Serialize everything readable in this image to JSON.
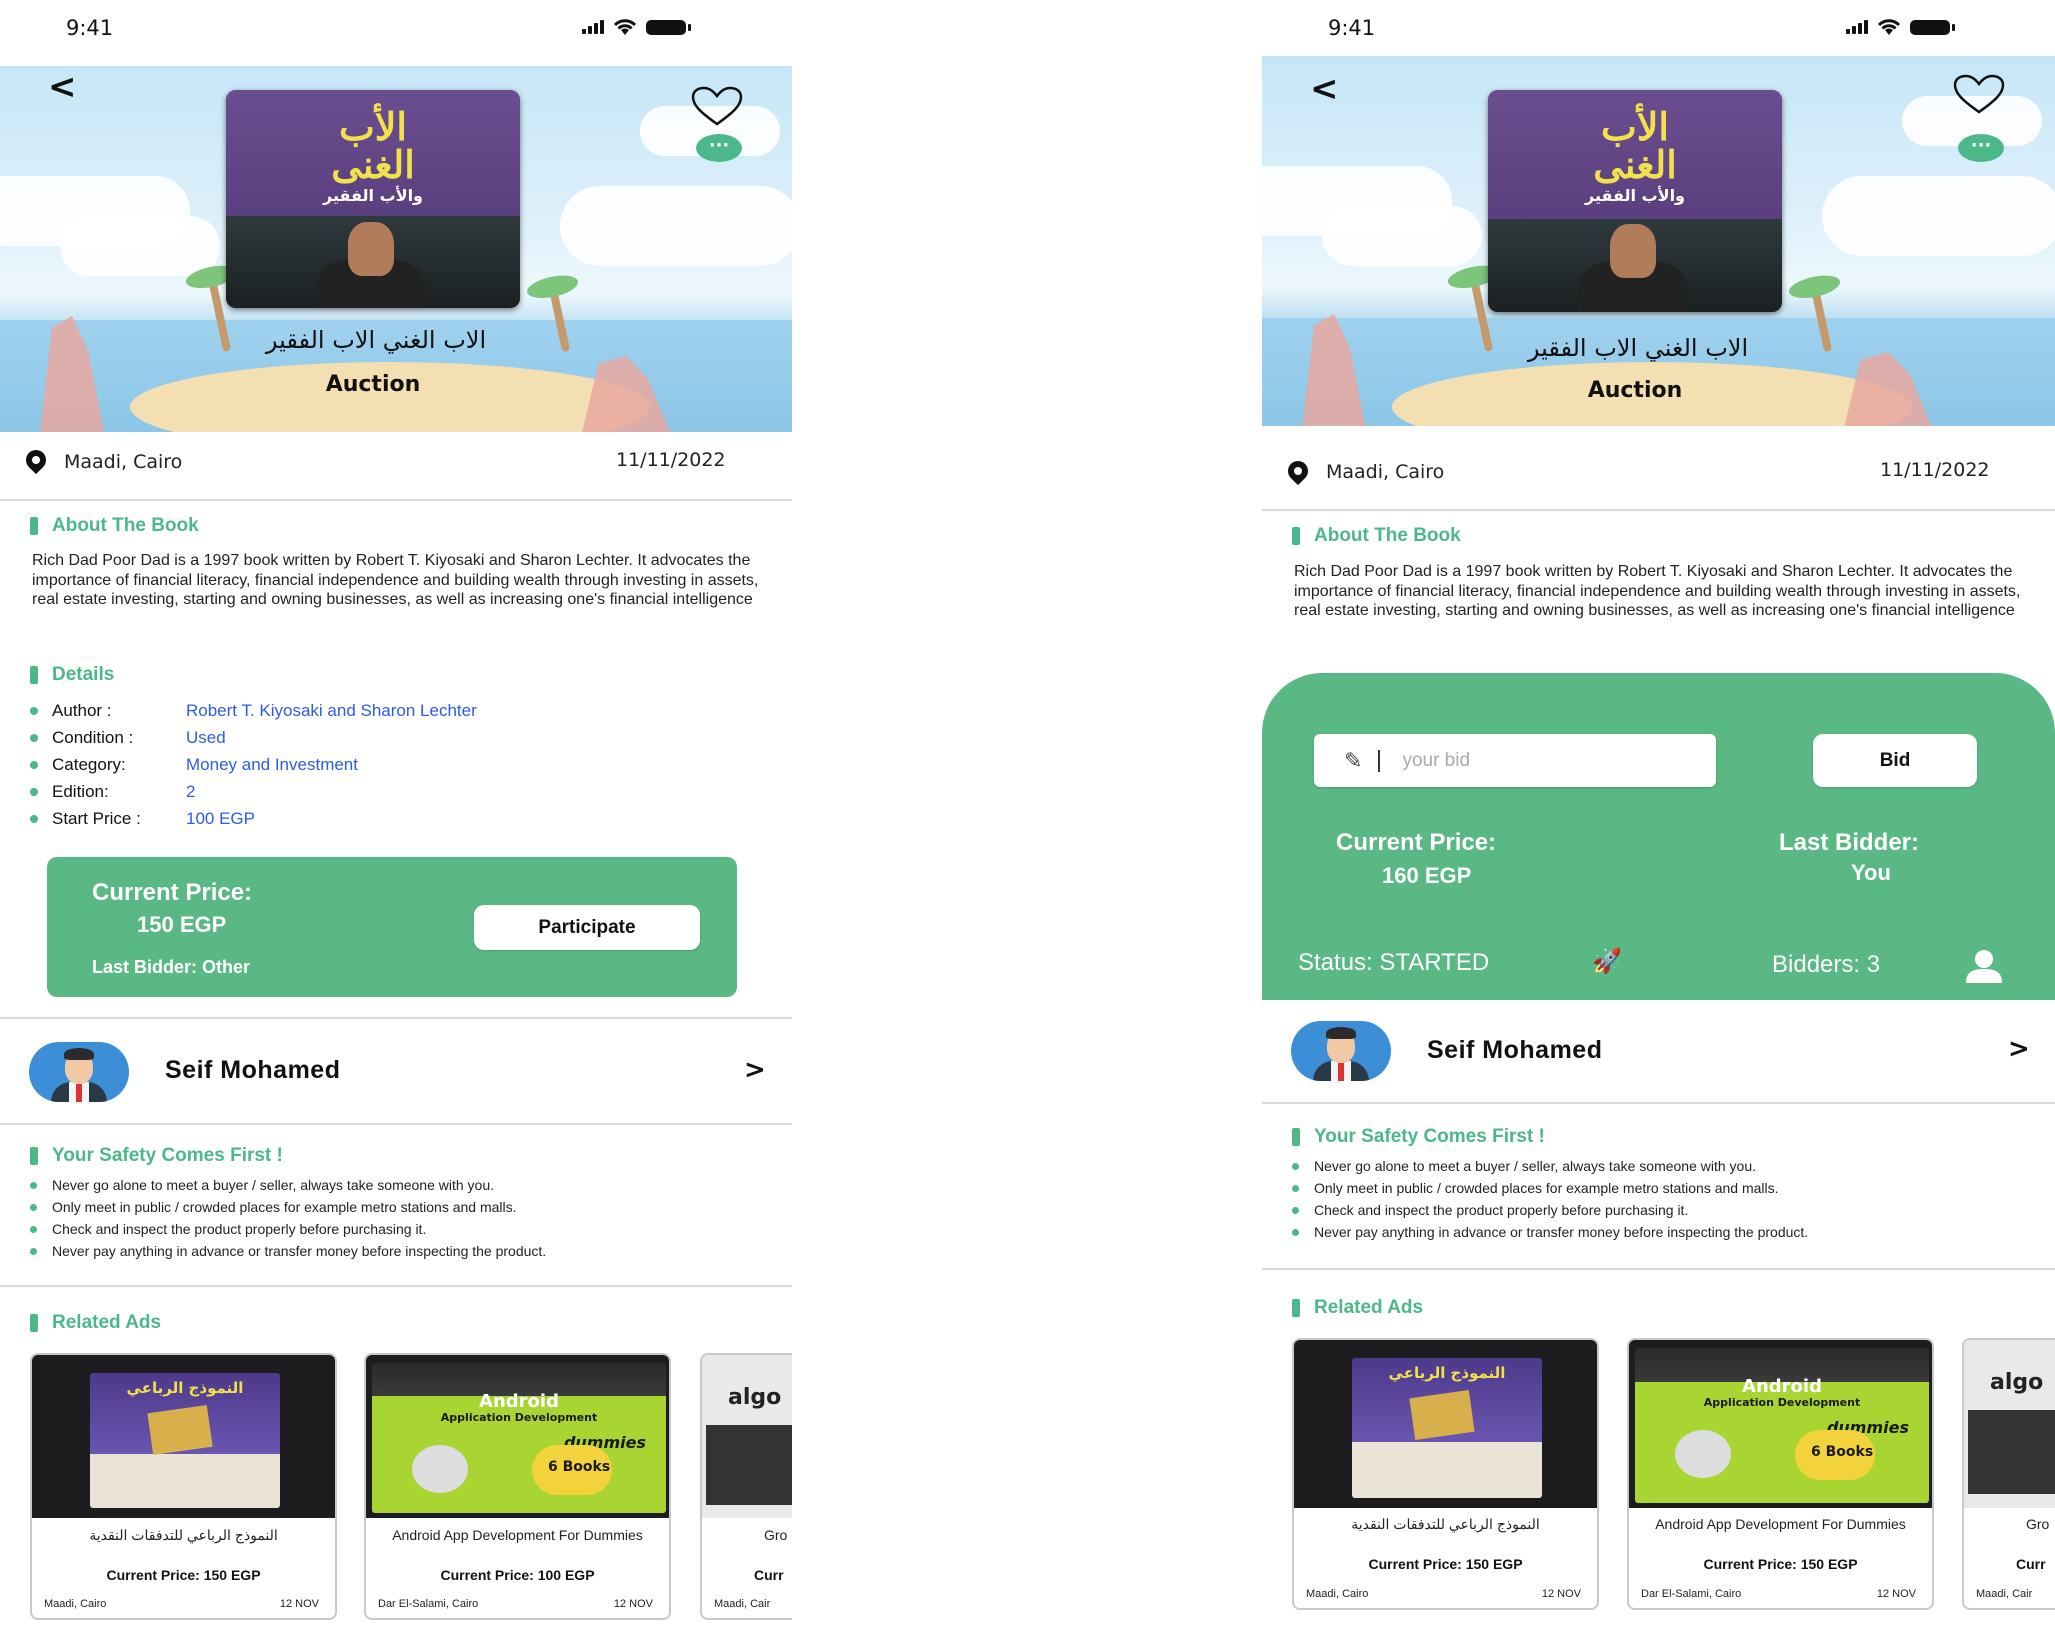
{
  "status_bar": {
    "time": "9:41"
  },
  "listing": {
    "title_ar": "الاب الغني الاب الفقير",
    "type": "Auction",
    "location": "Maadi, Cairo",
    "date": "11/11/2022",
    "cover": {
      "line1": "الأب",
      "line2": "الغنى",
      "line3": "والأب الفقير"
    }
  },
  "about": {
    "heading": "About The Book",
    "text": "Rich Dad Poor Dad is a 1997 book written by Robert T. Kiyosaki and Sharon Lechter. It advocates the importance of financial literacy, financial independence and building wealth through investing in assets, real estate investing, starting and owning businesses, as well as increasing one's financial intelligence"
  },
  "details": {
    "heading": "Details",
    "rows": [
      {
        "key": "Author :",
        "value": "Robert T. Kiyosaki and Sharon Lechter"
      },
      {
        "key": "Condition :",
        "value": "Used"
      },
      {
        "key": "Category:",
        "value": "Money and Investment"
      },
      {
        "key": "Edition:",
        "value": "2"
      },
      {
        "key": "Start Price :",
        "value": "100 EGP"
      }
    ]
  },
  "left_price_card": {
    "current_price_label": "Current Price:",
    "current_price": "150 EGP",
    "last_bidder": "Last Bidder: Other",
    "participate_label": "Participate"
  },
  "right_bid_panel": {
    "bid_placeholder": "your bid",
    "bid_button": "Bid",
    "current_price_label": "Current Price:",
    "current_price": "160 EGP",
    "last_bidder_label": "Last Bidder:",
    "last_bidder": "You",
    "status": "Status: STARTED",
    "bidders": "Bidders: 3"
  },
  "seller": {
    "name": "Seif Mohamed"
  },
  "safety": {
    "heading": "Your Safety Comes First !",
    "tips": [
      "Never go alone to meet a buyer / seller, always take someone with you.",
      "Only meet in public / crowded places for example metro stations and malls.",
      "Check and inspect the product properly before purchasing it.",
      "Never pay anything in advance or transfer money before inspecting the product."
    ]
  },
  "related": {
    "heading": "Related Ads",
    "left_ads": [
      {
        "title": "النموذج الرباعي للتدفقات النقدية",
        "price": "Current Price: 150 EGP",
        "location": "Maadi, Cairo",
        "date": "12 NOV"
      },
      {
        "title": "Android App Development For Dummies",
        "price": "Current Price: 100 EGP",
        "location": "Dar El-Salami, Cairo",
        "date": "12 NOV"
      },
      {
        "title": "Gro",
        "price": "Curr",
        "location": "Maadi, Cair",
        "date": ""
      }
    ],
    "right_ads": [
      {
        "title": "النموذج الرباعي للتدفقات النقدية",
        "price": "Current Price: 150 EGP",
        "location": "Maadi, Cairo",
        "date": "12 NOV"
      },
      {
        "title": "Android App Development For Dummies",
        "price": "Current Price: 150 EGP",
        "location": "Dar El-Salami, Cairo",
        "date": "12 NOV"
      },
      {
        "title": "Gro",
        "price": "Curr",
        "location": "Maadi, Cair",
        "date": ""
      }
    ],
    "thumb_texts": {
      "cashflow": "النموذج الرباعي",
      "android": "Android",
      "android_sub": "Application Development",
      "dummies": "dummies",
      "books": "6 Books",
      "grokking": "algo"
    }
  },
  "colors": {
    "accent": "#5ab884",
    "link": "#2e5be6"
  },
  "icons": [
    "back-icon",
    "heart-icon",
    "chat-icon",
    "pin-icon",
    "chevron-right-icon",
    "hammer-icon",
    "rocket-icon",
    "person-icon"
  ]
}
